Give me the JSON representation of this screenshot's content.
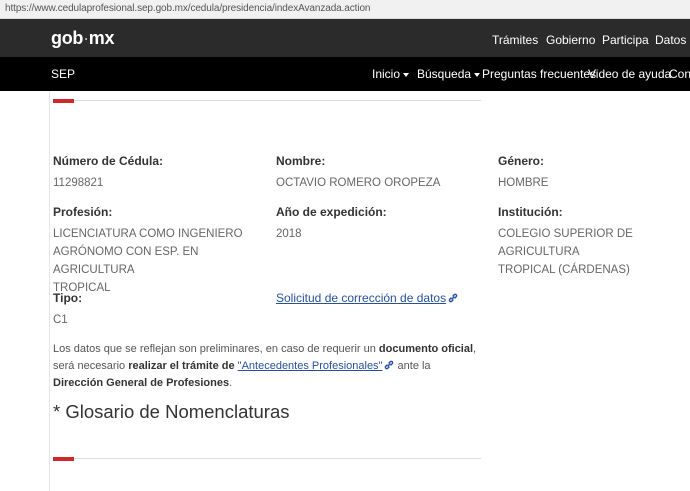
{
  "browser": {
    "url": "https://www.cedulaprofesional.sep.gob.mx/cedula/presidencia/indexAvanzada.action"
  },
  "gob_header": {
    "logo_main": "gob",
    "logo_dot": "·",
    "logo_tail": "mx",
    "nav": [
      "Trámites",
      "Gobierno",
      "Participa",
      "Datos"
    ]
  },
  "sep_header": {
    "brand": "SEP",
    "nav": [
      "Inicio",
      "Búsqueda",
      "Preguntas frecuentes",
      "Video de ayuda",
      "Contacto"
    ]
  },
  "record": {
    "cedula_label": "Número de Cédula:",
    "cedula_value": "11298821",
    "nombre_label": "Nombre:",
    "nombre_value": "OCTAVIO ROMERO OROPEZA",
    "genero_label": "Género:",
    "genero_value": "HOMBRE",
    "profesion_label": "Profesión:",
    "profesion_value_lines": [
      "LICENCIATURA COMO INGENIERO",
      "AGRÓNOMO CON ESP. EN AGRICULTURA",
      "TROPICAL"
    ],
    "anio_label": "Año de expedición:",
    "anio_value": "2018",
    "institucion_label": "Institución:",
    "institucion_value_lines": [
      "COLEGIO SUPERIOR DE AGRICULTURA",
      "TROPICAL (CÁRDENAS)"
    ],
    "tipo_label": "Tipo:",
    "tipo_value": "C1",
    "correction_link": "Solicitud de corrección de datos"
  },
  "note": {
    "part1": "Los datos que se reflejan son preliminares, en caso de requerir un ",
    "bold1": "documento oficial",
    "part2": ", será necesario ",
    "bold2": "realizar el trámite de ",
    "link": "\"Antecedentes Profesionales\"",
    "part3": " ante la ",
    "bold3": "Dirección General de Profesiones",
    "part4": "."
  },
  "glossary_heading": "* Glosario de Nomenclaturas",
  "colors": {
    "accent": "#d4262d",
    "link": "#2450a6",
    "gob_bar": "#2b2b2b",
    "sep_bar": "#000000"
  }
}
